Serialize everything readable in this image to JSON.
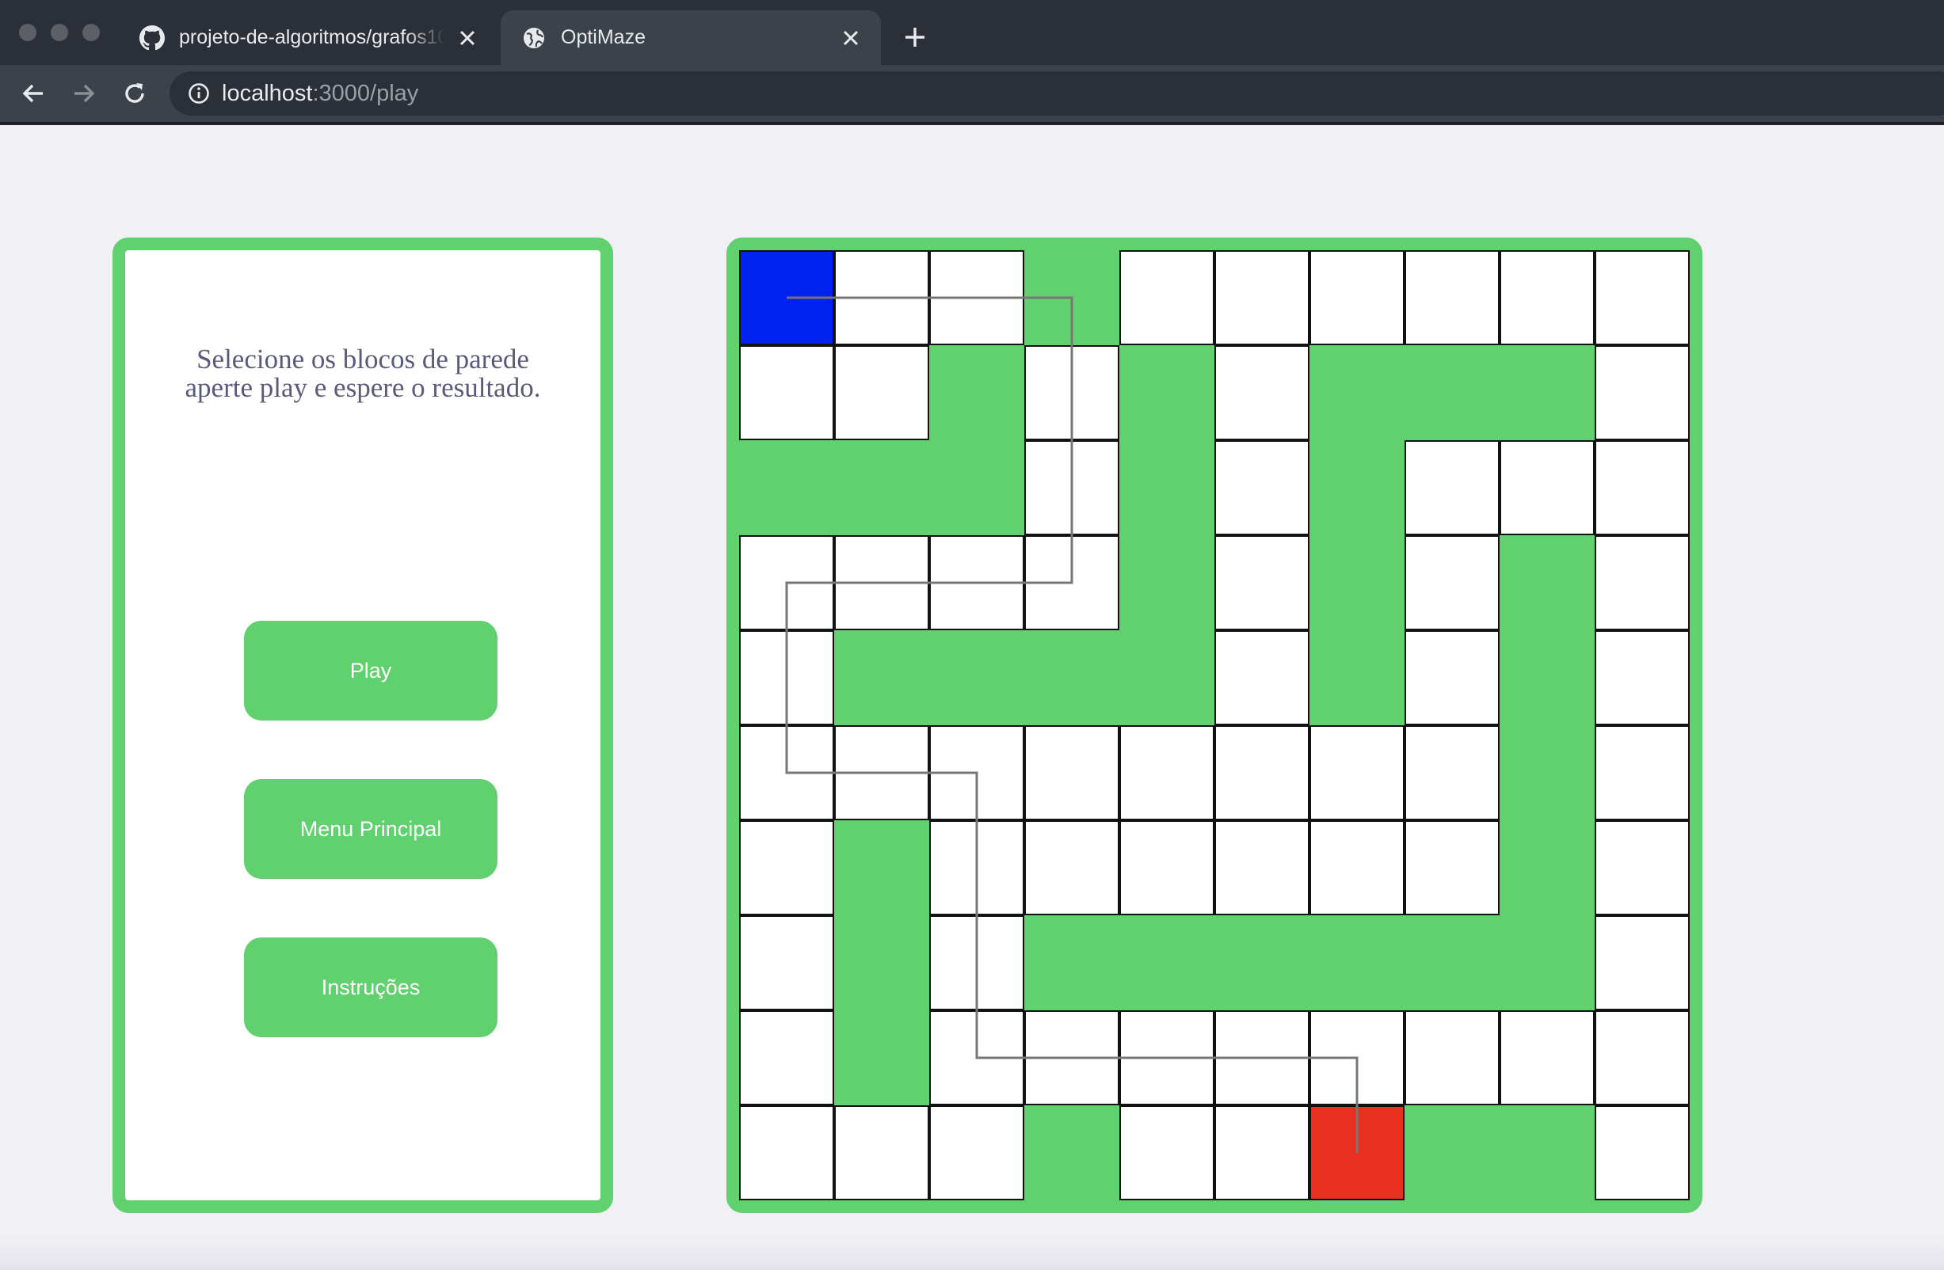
{
  "browser": {
    "tabs": [
      {
        "title": "projeto-de-algoritmos/grafos10",
        "icon": "github-icon",
        "active": false
      },
      {
        "title": "OptiMaze",
        "icon": "globe-icon",
        "active": true
      }
    ],
    "url_host": "localhost",
    "url_path": ":3000/play"
  },
  "side_panel": {
    "instructions": "Selecione os blocos de parede aperte play e espere o resultado.",
    "buttons": {
      "play": "Play",
      "main_menu": "Menu Principal",
      "instructions": "Instruções"
    }
  },
  "maze": {
    "rows": 10,
    "cols": 10,
    "legend": {
      "o": "open",
      "w": "wall",
      "s": "start",
      "e": "end"
    },
    "grid": [
      "ooowoooooo",
      "oowowowwwo",
      "wwwowowooo",
      "oooowowowo",
      "owwwwowowo",
      "oooooooowo",
      "owoooooowo",
      "owowwwwwwo",
      "owoooooooo",
      "ooowooowwo"
    ],
    "start": [
      0,
      0
    ],
    "end": [
      9,
      6
    ],
    "path": [
      [
        0,
        0
      ],
      [
        0,
        3
      ],
      [
        3,
        3
      ],
      [
        3,
        0
      ],
      [
        5,
        0
      ],
      [
        5,
        2
      ],
      [
        8,
        2
      ],
      [
        8,
        6
      ],
      [
        9,
        6
      ]
    ],
    "colors": {
      "wall": "#61d16f",
      "open": "#ffffff",
      "start": "#0022ee",
      "end": "#e8301f",
      "path": "#777777"
    }
  }
}
